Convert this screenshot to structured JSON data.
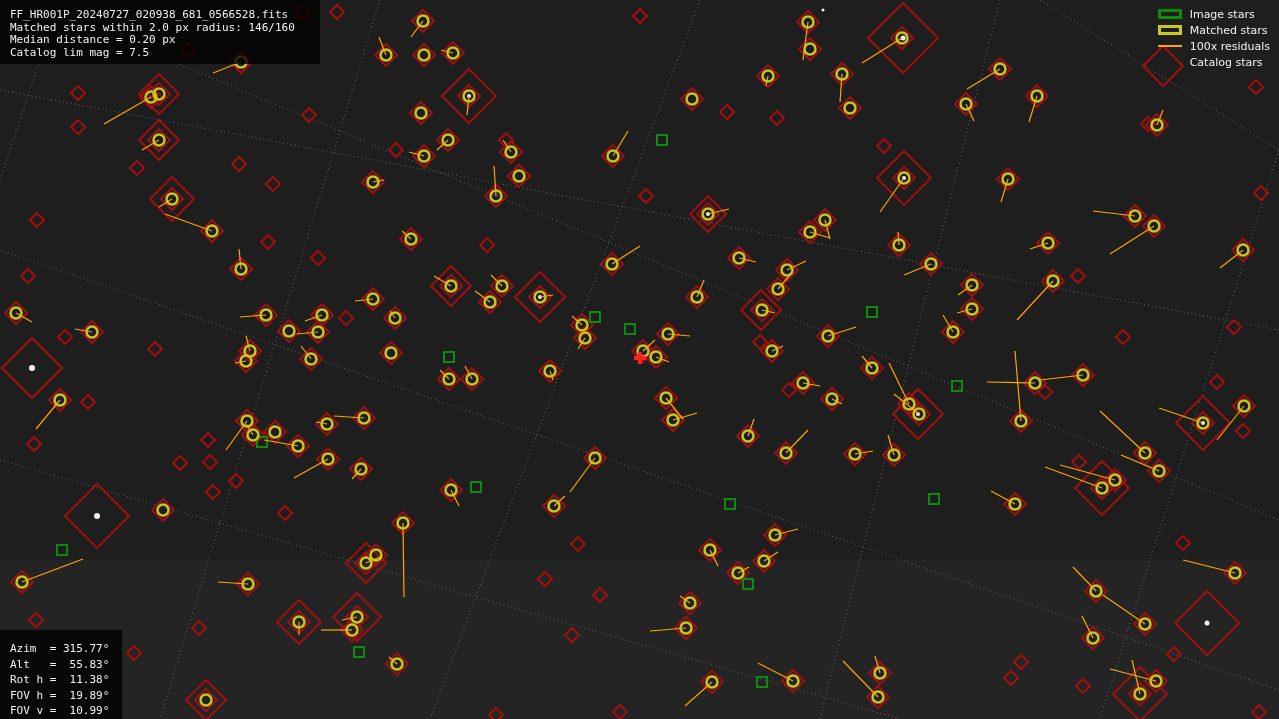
{
  "file_info": {
    "lines": [
      "FF_HR001P_20240727_020938_681_0566528.fits",
      "Matched stars within 2.0 px radius: 146/160",
      "Median distance = 0.20 px",
      "Catalog lim mag = 7.5"
    ]
  },
  "legend": {
    "items": [
      {
        "label": "Image stars",
        "color": "#0e8a0e"
      },
      {
        "kind": "matched",
        "label": "Matched stars",
        "color": "#c8c81e"
      },
      {
        "kind": "residual",
        "label": "100x residuals",
        "color": "#ffa500"
      },
      {
        "kind": "catalog",
        "label": "Catalog stars"
      }
    ]
  },
  "pointing": {
    "lines": [
      "Azim  = 315.77°",
      "Alt   =  55.83°",
      "Rot h =  11.38°",
      "FOV h =  19.89°",
      "FOV v =  10.99°"
    ]
  }
}
